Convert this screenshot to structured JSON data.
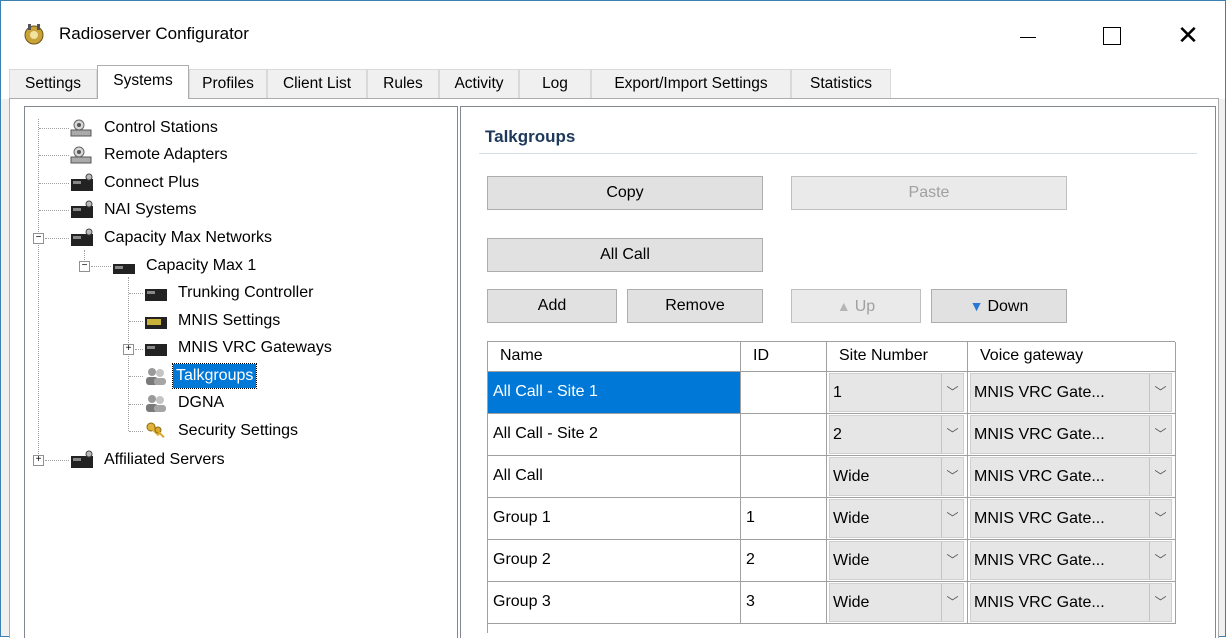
{
  "window": {
    "title": "Radioserver Configurator",
    "close_glyph": "✕"
  },
  "tabs": [
    {
      "label": "Settings"
    },
    {
      "label": "Systems"
    },
    {
      "label": "Profiles"
    },
    {
      "label": "Client List"
    },
    {
      "label": "Rules"
    },
    {
      "label": "Activity"
    },
    {
      "label": "Log"
    },
    {
      "label": "Export/Import Settings"
    },
    {
      "label": "Statistics"
    }
  ],
  "active_tab": "Systems",
  "tree": [
    {
      "label": "Control Stations",
      "icon": "station-icon"
    },
    {
      "label": "Remote Adapters",
      "icon": "station-icon"
    },
    {
      "label": "Connect Plus",
      "icon": "repeater-icon"
    },
    {
      "label": "NAI Systems",
      "icon": "repeater-icon"
    },
    {
      "label": "Capacity Max Networks",
      "icon": "repeater-icon"
    },
    {
      "label": "Capacity Max 1",
      "icon": "repeater-icon"
    },
    {
      "label": "Trunking Controller",
      "icon": "repeater-icon"
    },
    {
      "label": "MNIS Settings",
      "icon": "repeater-icon"
    },
    {
      "label": "MNIS VRC Gateways",
      "icon": "repeater-icon"
    },
    {
      "label": "Talkgroups",
      "icon": "users-icon"
    },
    {
      "label": "DGNA",
      "icon": "users-icon"
    },
    {
      "label": "Security Settings",
      "icon": "keys-icon"
    },
    {
      "label": "Affiliated Servers",
      "icon": "repeater-icon"
    }
  ],
  "expander": {
    "minus": "−",
    "plus": "+"
  },
  "talkgroups": {
    "title": "Talkgroups",
    "buttons": {
      "copy": "Copy",
      "paste": "Paste",
      "all_call": "All Call",
      "add": "Add",
      "remove": "Remove",
      "up": "Up",
      "down": "Down"
    },
    "button_icons": {
      "up": "▲",
      "down": "▼"
    },
    "dropdown_glyph": "﹀",
    "columns": [
      "Name",
      "ID",
      "Site Number",
      "Voice gateway"
    ],
    "rows": [
      {
        "name": "All Call - Site 1",
        "id": "",
        "site": "1",
        "gateway": "MNIS VRC Gate..."
      },
      {
        "name": "All Call - Site 2",
        "id": "",
        "site": "2",
        "gateway": "MNIS VRC Gate..."
      },
      {
        "name": "All Call",
        "id": "",
        "site": "Wide",
        "gateway": "MNIS VRC Gate..."
      },
      {
        "name": "Group 1",
        "id": "1",
        "site": "Wide",
        "gateway": "MNIS VRC Gate..."
      },
      {
        "name": "Group 2",
        "id": "2",
        "site": "Wide",
        "gateway": "MNIS VRC Gate..."
      },
      {
        "name": "Group 3",
        "id": "3",
        "site": "Wide",
        "gateway": "MNIS VRC Gate..."
      }
    ]
  },
  "colors": {
    "selection": "#0078d7",
    "heading": "#1e395b",
    "arrow_blue": "#2b78d4"
  }
}
